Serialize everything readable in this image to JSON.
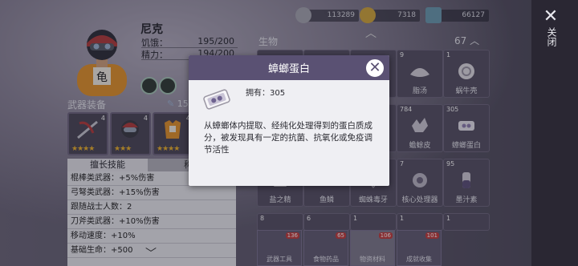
{
  "character": {
    "name": "尼克",
    "stats": [
      {
        "label": "饥饿：",
        "value": "195/200"
      },
      {
        "label": "精力：",
        "value": "194/200"
      }
    ]
  },
  "equipment": {
    "title": "武器装备",
    "score": "150",
    "slots": [
      {
        "badge": "4",
        "stars": "★★★★",
        "icon": "crossbow-icon"
      },
      {
        "badge": "4",
        "stars": "★★★",
        "icon": "helmet-icon"
      },
      {
        "badge": "4",
        "stars": "★★★★",
        "icon": "armor-icon"
      }
    ]
  },
  "skills": {
    "tab_active": "擅长技能",
    "tab_other": "称号",
    "items": [
      "棍棒类武器：+5%伤害",
      "弓弩类武器：+15%伤害",
      "跟随战士人数：2",
      "刀斧类武器：+10%伤害",
      "移动速度：+10%",
      "基础生命：+500"
    ]
  },
  "resources": [
    {
      "icon": "coin-stack-icon",
      "value": "113289"
    },
    {
      "icon": "gold-coin-icon",
      "value": "7318"
    },
    {
      "icon": "ticket-icon",
      "value": "66127"
    }
  ],
  "inventory": {
    "title": "生物",
    "count": "67",
    "slots": [
      {
        "count": "",
        "label": "",
        "icon": "chest-icon"
      },
      {
        "count": "",
        "label": "",
        "icon": "insect-icon"
      },
      {
        "count": "",
        "label": "",
        "icon": "flower-icon"
      },
      {
        "count": "9",
        "label": "脂汤",
        "icon": "shell-icon"
      },
      {
        "count": "1",
        "label": "蜗牛壳",
        "icon": "snail-shell-icon"
      },
      {
        "count": "",
        "label": "",
        "icon": "bone-icon"
      },
      {
        "count": "",
        "label": "",
        "icon": "bone-icon"
      },
      {
        "count": "",
        "label": "",
        "icon": "bone-icon"
      },
      {
        "count": "784",
        "label": "蟾蜍皮",
        "icon": "toad-skin-icon"
      },
      {
        "count": "305",
        "label": "蟑螂蛋白",
        "icon": "protein-icon"
      },
      {
        "count": "",
        "label": "盐之精",
        "icon": "salt-icon"
      },
      {
        "count": "",
        "label": "鱼鳞",
        "icon": "fish-scale-icon"
      },
      {
        "count": "",
        "label": "蜘蛛毒牙",
        "icon": "spider-fang-icon"
      },
      {
        "count": "7",
        "label": "核心处理器",
        "icon": "processor-icon"
      },
      {
        "count": "95",
        "label": "墨汁素",
        "icon": "ink-icon"
      },
      {
        "count": "8",
        "label": "",
        "icon": "blank-icon"
      },
      {
        "count": "6",
        "label": "",
        "icon": "blank-icon"
      },
      {
        "count": "1",
        "label": "",
        "icon": "blank-icon"
      },
      {
        "count": "1",
        "label": "",
        "icon": "blank-icon"
      },
      {
        "count": "1",
        "label": "",
        "icon": "blank-icon"
      }
    ],
    "categories": [
      {
        "label": "武器工具",
        "badge": "136"
      },
      {
        "label": "食物药品",
        "badge": "65"
      },
      {
        "label": "物资材料",
        "badge": "106"
      },
      {
        "label": "成就收集",
        "badge": "101"
      }
    ]
  },
  "close_label": "关闭",
  "popup": {
    "title": "蟑螂蛋白",
    "owned_label": "拥有：305",
    "description": "从蟑螂体内提取、经纯化处理得到的蛋白质成分，被发现具有一定的抗菌、抗氧化或免疫调节活性"
  },
  "colors": {
    "popup_header": "#5a5173",
    "star": "#f0b429",
    "badge_red": "#c43b3b"
  }
}
